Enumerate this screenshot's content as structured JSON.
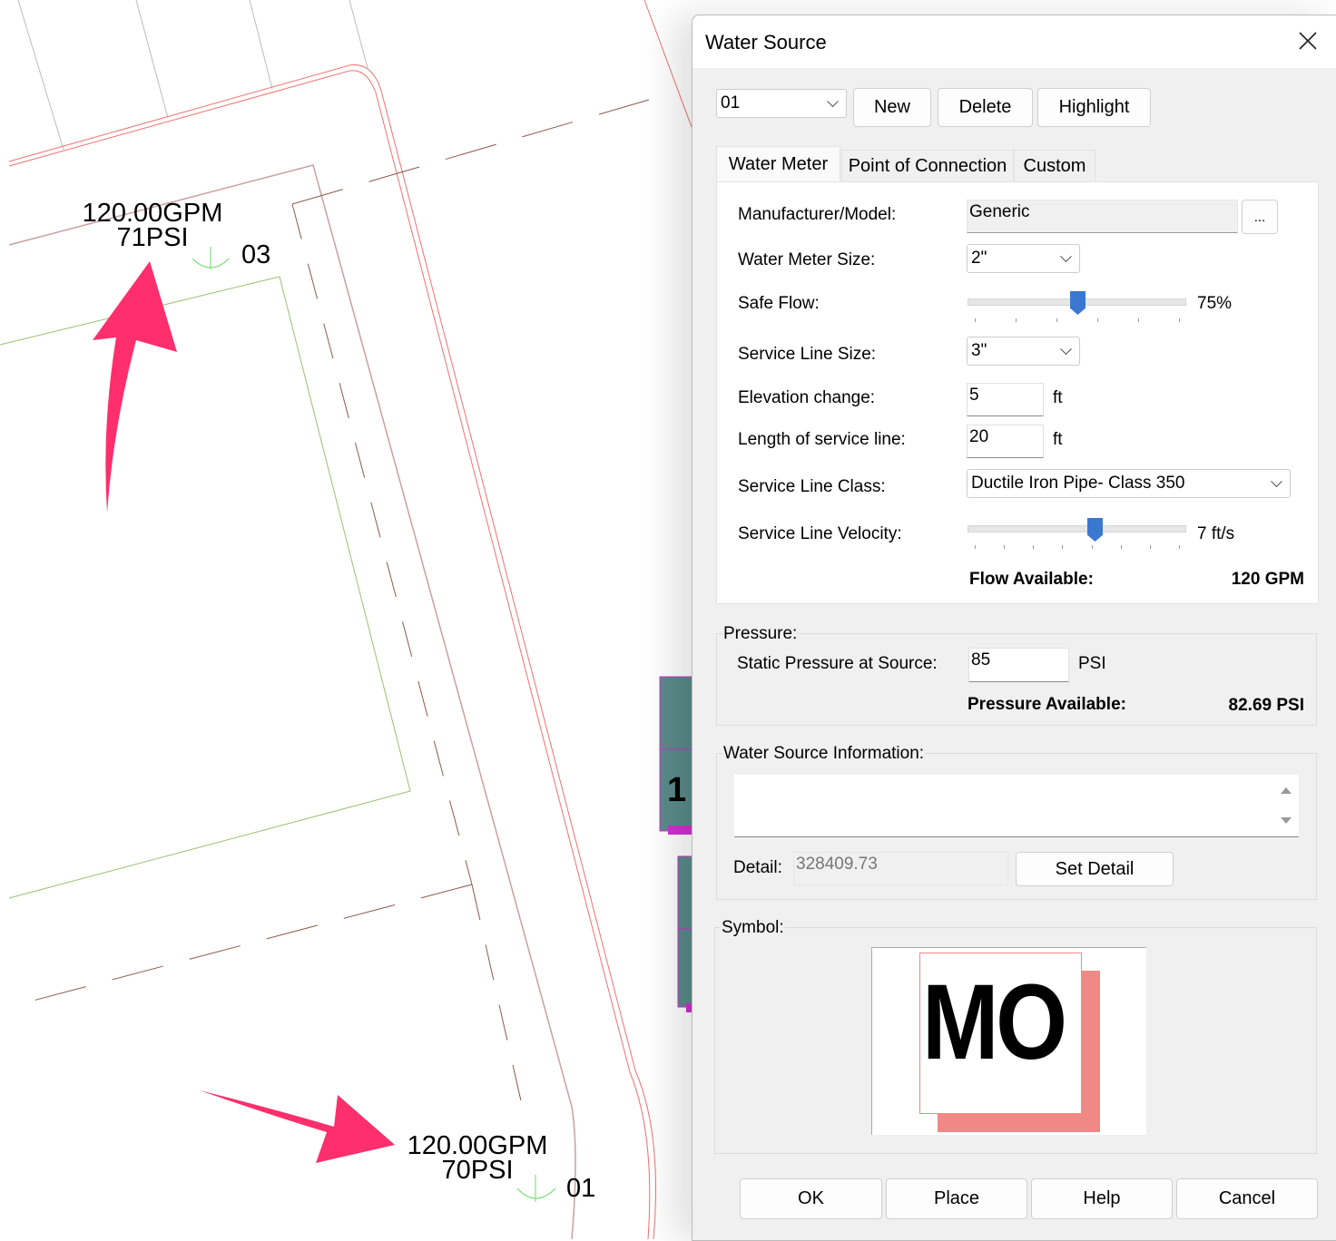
{
  "drawing": {
    "labels": [
      {
        "flow": "120.00GPM",
        "pressure": "71PSI",
        "id": "03"
      },
      {
        "flow": "120.00GPM",
        "pressure": "70PSI",
        "id": "01"
      }
    ],
    "partial_label": "1",
    "arrow_color": "#ff2e6c"
  },
  "dialog": {
    "title": "Water Source",
    "source_select": "01",
    "buttons": {
      "new": "New",
      "delete": "Delete",
      "highlight": "Highlight"
    },
    "tabs": [
      {
        "label": "Water Meter",
        "selected": true
      },
      {
        "label": "Point of Connection",
        "selected": false
      },
      {
        "label": "Custom",
        "selected": false
      }
    ],
    "water_meter": {
      "manufacturer_label": "Manufacturer/Model:",
      "manufacturer_value": "Generic",
      "browse_label": "...",
      "meter_size_label": "Water Meter Size:",
      "meter_size_value": "2\"",
      "safe_flow_label": "Safe Flow:",
      "safe_flow_value": "75%",
      "service_line_size_label": "Service Line Size:",
      "service_line_size_value": "3\"",
      "elevation_label": "Elevation change:",
      "elevation_value": "5",
      "elevation_unit": "ft",
      "length_label": "Length of service line:",
      "length_value": "20",
      "length_unit": "ft",
      "class_label": "Service Line Class:",
      "class_value": "Ductile Iron Pipe- Class 350",
      "velocity_label": "Service Line Velocity:",
      "velocity_value": "7 ft/s",
      "flow_available_label": "Flow Available:",
      "flow_available_value": "120 GPM"
    },
    "pressure": {
      "legend": "Pressure:",
      "static_label": "Static Pressure at Source:",
      "static_value": "85",
      "static_unit": "PSI",
      "available_label": "Pressure Available:",
      "available_value": "82.69 PSI"
    },
    "info": {
      "legend": "Water Source Information:",
      "text": "",
      "detail_label": "Detail:",
      "detail_value": "328409.73",
      "set_detail": "Set Detail"
    },
    "symbol": {
      "legend": "Symbol:",
      "text": "MO",
      "color": "#f08884"
    },
    "footer": {
      "ok": "OK",
      "place": "Place",
      "help": "Help",
      "cancel": "Cancel"
    },
    "accent": "#3a78d0"
  }
}
